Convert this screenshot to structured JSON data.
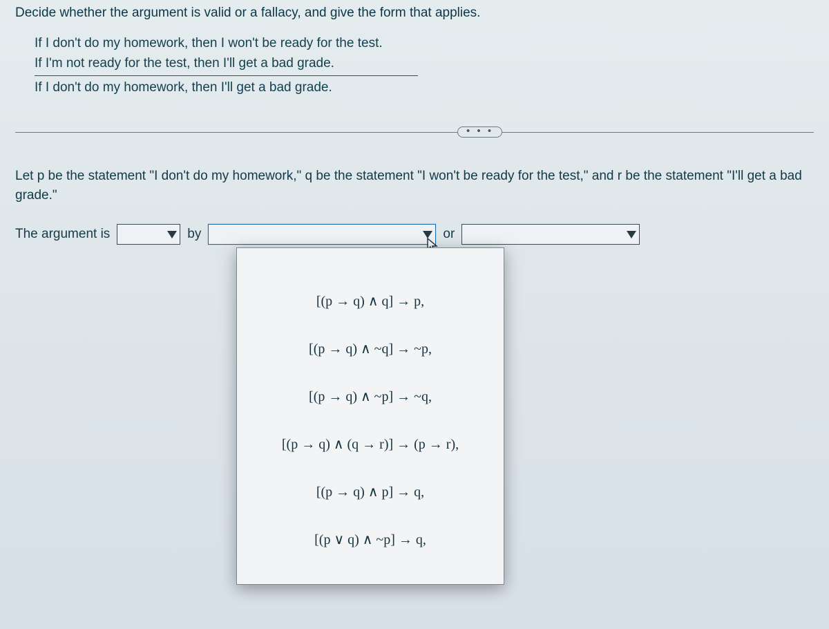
{
  "question": "Decide whether the argument is valid or a fallacy, and give the form that applies.",
  "premises": {
    "p1": "If I don't do my homework, then I won't be ready for the test.",
    "p2": "If I'm not ready for the test, then I'll get a bad grade.",
    "conclusion": "If I don't do my homework, then I'll get a bad grade."
  },
  "ellipsis": "• • •",
  "definition": "Let p be the statement \"I don't do my homework,\" q be the statement \"I won't be ready for the test,\" and r be the statement \"I'll get a bad grade.\"",
  "answer": {
    "lead": "The argument is",
    "by": "by",
    "or": "or"
  },
  "options": [
    "[(p → q) ∧ q] → p,",
    "[(p → q) ∧ ~q] → ~p,",
    "[(p → q) ∧ ~p] → ~q,",
    "[(p → q) ∧ (q → r)] → (p → r),",
    "[(p → q) ∧ p] → q,",
    "[(p ∨ q) ∧ ~p] → q,"
  ]
}
